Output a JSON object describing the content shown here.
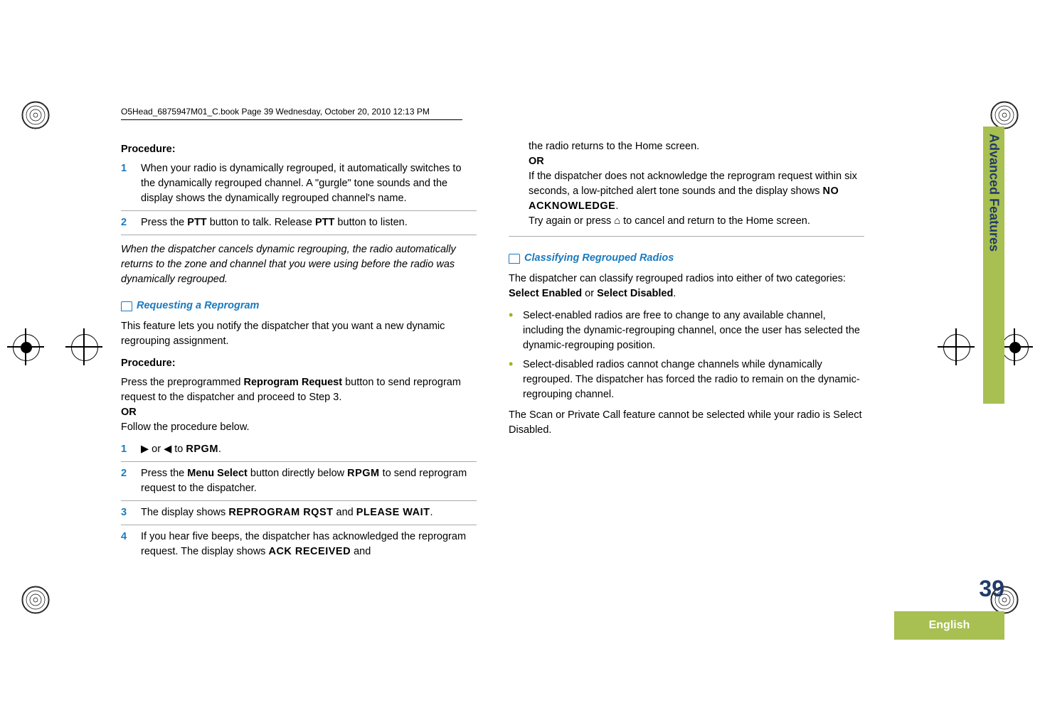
{
  "header": "O5Head_6875947M01_C.book  Page 39  Wednesday, October 20, 2010  12:13 PM",
  "left": {
    "proc": "Procedure:",
    "s1": {
      "n": "1",
      "t": "When your radio is dynamically regrouped, it automatically switches to the dynamically regrouped channel. A \"gurgle\" tone sounds and the display shows the dynamically regrouped channel's name."
    },
    "s2": {
      "n": "2",
      "t1": "Press the ",
      "b1": "PTT",
      "t2": " button to talk. Release ",
      "b2": "PTT",
      "t3": " button to listen."
    },
    "note": "When the dispatcher cancels dynamic regrouping, the radio automatically returns to the zone and channel that you were using before the radio was dynamically regrouped.",
    "sect1": "Requesting a Reprogram",
    "p1": "This feature lets you notify the dispatcher that you want a new dynamic regrouping assignment.",
    "proc2": "Procedure:",
    "p2a": "Press the preprogrammed ",
    "p2b": "Reprogram Request",
    "p2c": " button to send reprogram request to the dispatcher and proceed to Step 3.",
    "or": "OR",
    "p3": "Follow the procedure below.",
    "r1": {
      "n": "1",
      "t1": "▶ or ◀ to ",
      "d": "RPGM",
      "t2": "."
    },
    "r2": {
      "n": "2",
      "t1": "Press the ",
      "b": "Menu Select",
      "t2": " button directly below ",
      "d": "RPGM",
      "t3": " to send reprogram request to the dispatcher."
    },
    "r3": {
      "n": "3",
      "t1": "The display shows ",
      "d1": "REPROGRAM RQST",
      "t2": " and ",
      "d2": "PLEASE WAIT",
      "t3": "."
    },
    "r4": {
      "n": "4",
      "t1": "If you hear five beeps, the dispatcher has acknowledged the reprogram request. The display shows ",
      "d": "ACK RECEIVED",
      "t2": " and"
    }
  },
  "right": {
    "p1": "the radio returns to the Home screen.",
    "or": "OR",
    "p2a": "If the dispatcher does not acknowledge the reprogram request within six seconds, a low-pitched alert tone sounds and the display shows ",
    "p2d": "NO ACKNOWLEDGE",
    "p2b": ".",
    "p3a": "Try again or press ",
    "p3b": " to cancel and return to the Home screen.",
    "sect": "Classifying Regrouped Radios",
    "intro1": "The dispatcher can classify regrouped radios into either of two categories: ",
    "intro_b1": "Select Enabled",
    "intro2": " or ",
    "intro_b2": "Select Disabled",
    "intro3": ".",
    "b1": "Select-enabled radios are free to change to any available channel, including the dynamic-regrouping channel, once the user has selected the dynamic-regrouping position.",
    "b2": "Select-disabled radios cannot change channels while dynamically regrouped. The dispatcher has forced the radio to remain on the dynamic-regrouping channel.",
    "p4": "The Scan or Private Call feature cannot be selected while your radio is Select Disabled."
  },
  "sidebar": "Advanced Features",
  "pagenum": "39",
  "english": "English"
}
